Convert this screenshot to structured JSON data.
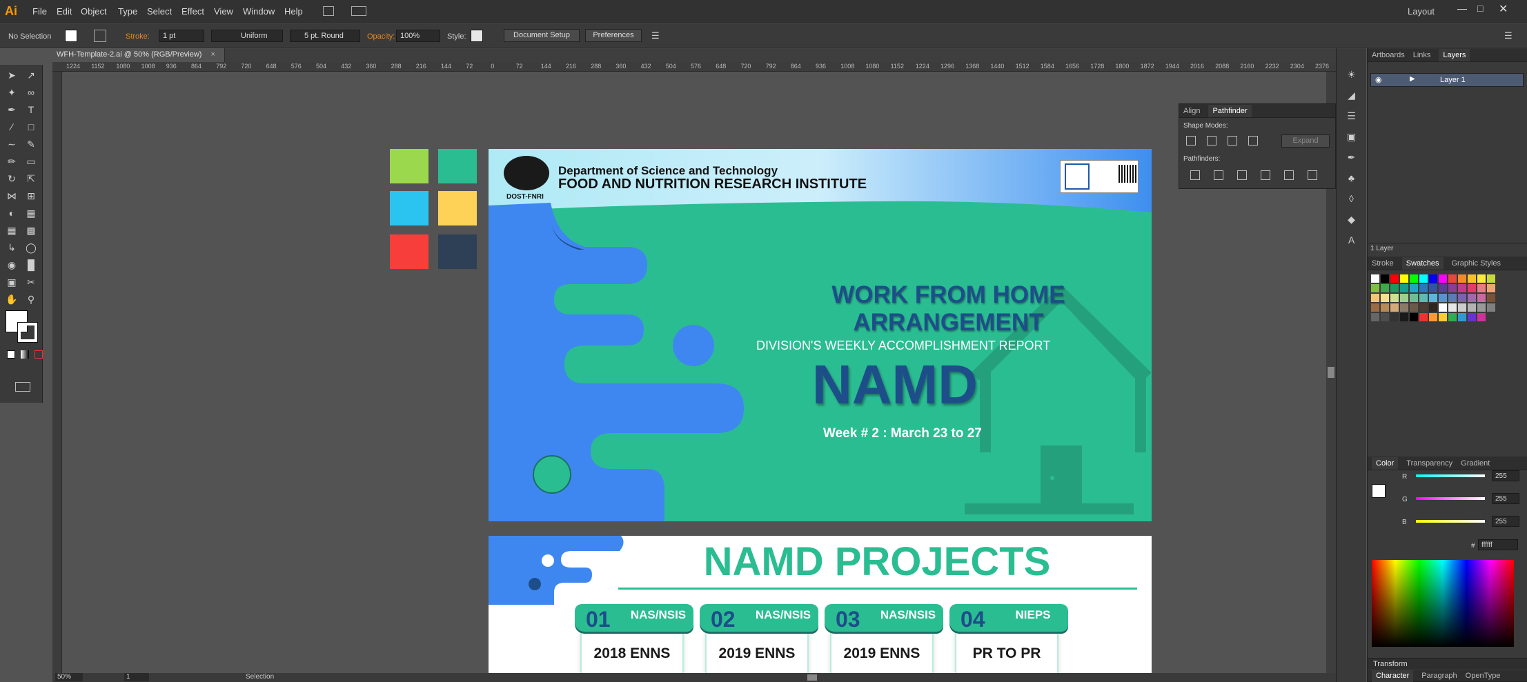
{
  "app": {
    "logo": "Ai",
    "workspace": "Layout"
  },
  "menu": [
    "File",
    "Edit",
    "Object",
    "Type",
    "Select",
    "Effect",
    "View",
    "Window",
    "Help"
  ],
  "control": {
    "selection": "No Selection",
    "stroke_label": "Stroke:",
    "stroke_value": "1 pt",
    "stroke_profile": "Uniform",
    "brush": "5 pt. Round",
    "opacity_label": "Opacity:",
    "opacity_value": "100%",
    "style_label": "Style:",
    "doc_setup": "Document Setup",
    "preferences": "Preferences"
  },
  "document": {
    "tab_title": "WFH-Template-2.ai @ 50% (RGB/Preview)"
  },
  "ruler": {
    "ticks": [
      "1224",
      "1152",
      "1080",
      "1008",
      "936",
      "864",
      "792",
      "720",
      "648",
      "576",
      "504",
      "432",
      "360",
      "288",
      "216",
      "144",
      "72",
      "0",
      "72",
      "144",
      "216",
      "288",
      "360",
      "432",
      "504",
      "576",
      "648",
      "720",
      "792",
      "864",
      "936",
      "1008",
      "1080",
      "1152",
      "1224",
      "1296",
      "1368",
      "1440",
      "1512",
      "1584",
      "1656",
      "1728",
      "1800",
      "1872",
      "1944",
      "2016",
      "2088",
      "2160",
      "2232",
      "2304",
      "2376"
    ]
  },
  "swatches_left": [
    "#9bd84d",
    "#2bbd92",
    "#2bc3f0",
    "#fdd257",
    "#f73e3b",
    "#2e4055"
  ],
  "artboard1": {
    "dept": "Department of Science and Technology",
    "institute": "FOOD AND NUTRITION RESEARCH INSTITUTE",
    "logo_caption": "DOST-FNRI",
    "headline": "WORK FROM HOME ARRANGEMENT",
    "subheadline": "DIVISION'S WEEKLY ACCOMPLISHMENT REPORT",
    "division": "NAMD",
    "week": "Week # 2 : March 23 to 27"
  },
  "artboard2": {
    "title": "NAMD PROJECTS",
    "cards": [
      {
        "num": "01",
        "tag": "NAS/NSIS",
        "label": "2018 ENNS"
      },
      {
        "num": "02",
        "tag": "NAS/NSIS",
        "label": "2019 ENNS"
      },
      {
        "num": "03",
        "tag": "NAS/NSIS",
        "label": "2019 ENNS"
      },
      {
        "num": "04",
        "tag": "NIEPS",
        "label": "PR TO PR"
      }
    ]
  },
  "pathfinder": {
    "tab_align": "Align",
    "tab_pathfinder": "Pathfinder",
    "shape_modes": "Shape Modes:",
    "pathfinders": "Pathfinders:",
    "expand": "Expand"
  },
  "layers": {
    "tabs": [
      "Artboards",
      "Links",
      "Layers"
    ],
    "layer_name": "Layer 1",
    "count": "1 Layer"
  },
  "swatches_panel": {
    "tabs": [
      "Stroke",
      "Swatches",
      "Graphic Styles"
    ]
  },
  "color_panel": {
    "tabs": [
      "Color",
      "Transparency",
      "Gradient"
    ],
    "r": "255",
    "g": "255",
    "b": "255",
    "hex": "ffffff",
    "r_label": "R",
    "g_label": "G",
    "b_label": "B",
    "hash": "#"
  },
  "bottom_panels": {
    "transform": "Transform",
    "tabs": [
      "Character",
      "Paragraph",
      "OpenType"
    ]
  },
  "status": {
    "zoom": "50%",
    "page": "1",
    "tool": "Selection"
  }
}
